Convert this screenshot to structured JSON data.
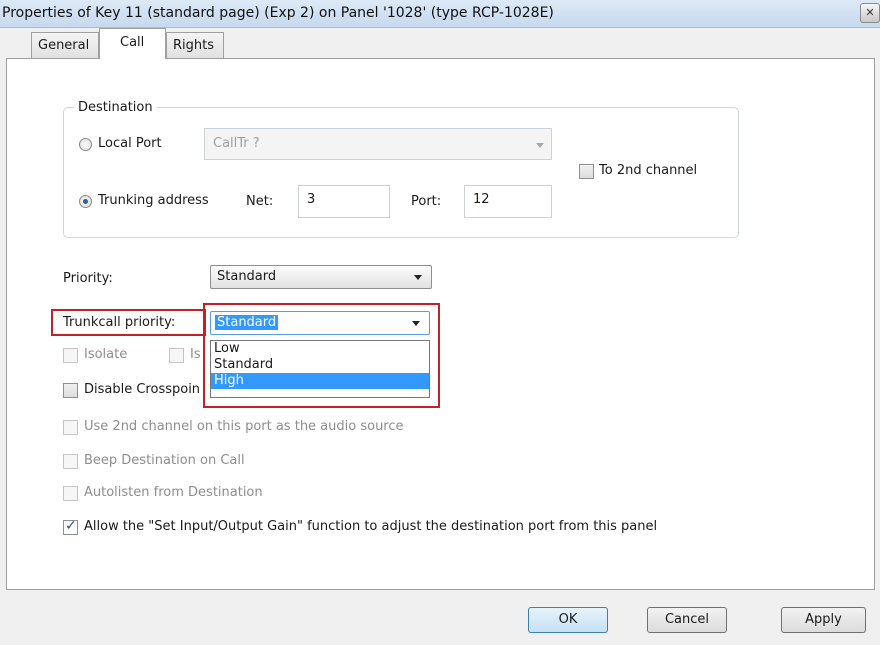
{
  "window": {
    "title": "Properties of Key 11 (standard page) (Exp 2) on Panel '1028' (type RCP-1028E)"
  },
  "tabs": [
    {
      "label": "General",
      "active": false
    },
    {
      "label": "Call",
      "active": true
    },
    {
      "label": "Rights",
      "active": false
    }
  ],
  "destination": {
    "group_label": "Destination",
    "local_port": {
      "label": "Local Port",
      "selected": false,
      "value": "CallTr ?"
    },
    "trunking": {
      "label": "Trunking address",
      "selected": true,
      "net_label": "Net:",
      "net_value": "3",
      "port_label": "Port:",
      "port_value": "12"
    },
    "second_channel": {
      "label": "To 2nd channel",
      "checked": false
    }
  },
  "priority": {
    "label": "Priority:",
    "value": "Standard"
  },
  "trunkcall": {
    "label": "Trunkcall priority:",
    "value": "Standard",
    "options": [
      "Low",
      "Standard",
      "High"
    ],
    "highlighted": "High"
  },
  "isolate": {
    "label": "Isolate",
    "partial_label": "Is"
  },
  "disable_crosspoint": {
    "label": "Disable Crosspoin"
  },
  "options": {
    "use_2nd_channel": "Use 2nd channel on this port as the audio source",
    "beep_destination": "Beep Destination on Call",
    "autolisten": "Autolisten from Destination",
    "allow_gain": "Allow the \"Set Input/Output Gain\" function to adjust the destination port from this panel"
  },
  "buttons": {
    "ok": "OK",
    "cancel": "Cancel",
    "apply": "Apply"
  },
  "colors": {
    "accent": "#3399ff",
    "highlight_box": "#c4202a"
  },
  "icons": {
    "close": "close-icon",
    "dropdown": "chevron-down-icon",
    "check": "checkmark-icon"
  }
}
